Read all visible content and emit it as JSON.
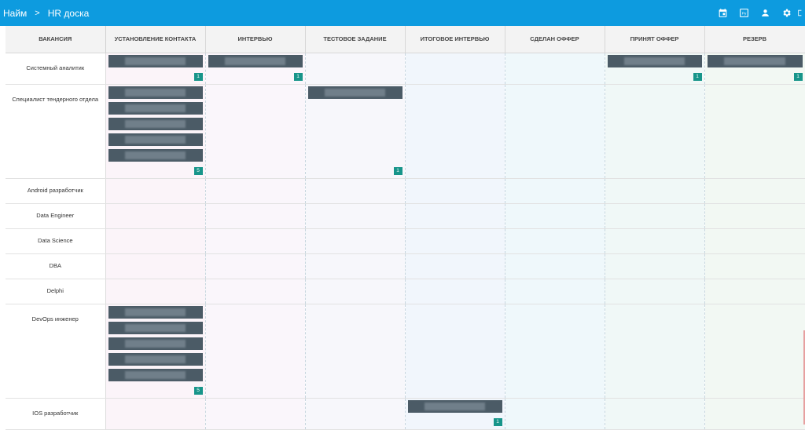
{
  "header": {
    "crumb_root": "Найм",
    "crumb_sep": ">",
    "crumb_page": "HR доска",
    "accent": "#0d9bdf",
    "icons": [
      "calendar-icon",
      "python-icon",
      "person-icon",
      "gear-icon",
      "logout-icon"
    ],
    "python_badge": "Py"
  },
  "board": {
    "columns": [
      "ВАКАНСИЯ",
      "УСТАНОВЛЕНИЕ КОНТАКТА",
      "ИНТЕРВЬЮ",
      "ТЕСТОВОЕ ЗАДАНИЕ",
      "ИТОГОВОЕ ИНТЕРВЬЮ",
      "СДЕЛАН ОФФЕР",
      "ПРИНЯТ ОФФЕР",
      "РЕЗЕРВ"
    ],
    "rows": [
      {
        "vacancy": "Системный аналитик",
        "cells": [
          1,
          1,
          0,
          0,
          0,
          1,
          1
        ]
      },
      {
        "vacancy": "Специалист тендерного отдела",
        "cells": [
          5,
          0,
          1,
          0,
          0,
          0,
          0
        ]
      },
      {
        "vacancy": "Android разработчик",
        "cells": [
          0,
          0,
          0,
          0,
          0,
          0,
          0
        ]
      },
      {
        "vacancy": "Data Engineer",
        "cells": [
          0,
          0,
          0,
          0,
          0,
          0,
          0
        ]
      },
      {
        "vacancy": "Data Science",
        "cells": [
          0,
          0,
          0,
          0,
          0,
          0,
          0
        ]
      },
      {
        "vacancy": "DBA",
        "cells": [
          0,
          0,
          0,
          0,
          0,
          0,
          0
        ]
      },
      {
        "vacancy": "Delphi",
        "cells": [
          0,
          0,
          0,
          0,
          0,
          0,
          0
        ]
      },
      {
        "vacancy": "DevOps инженер",
        "cells": [
          5,
          0,
          0,
          0,
          0,
          0,
          0
        ]
      },
      {
        "vacancy": "IOS разработчик",
        "cells": [
          0,
          0,
          0,
          1,
          0,
          0,
          0
        ]
      }
    ],
    "card_color": "#4b5b66",
    "count_color": "#17958a"
  }
}
